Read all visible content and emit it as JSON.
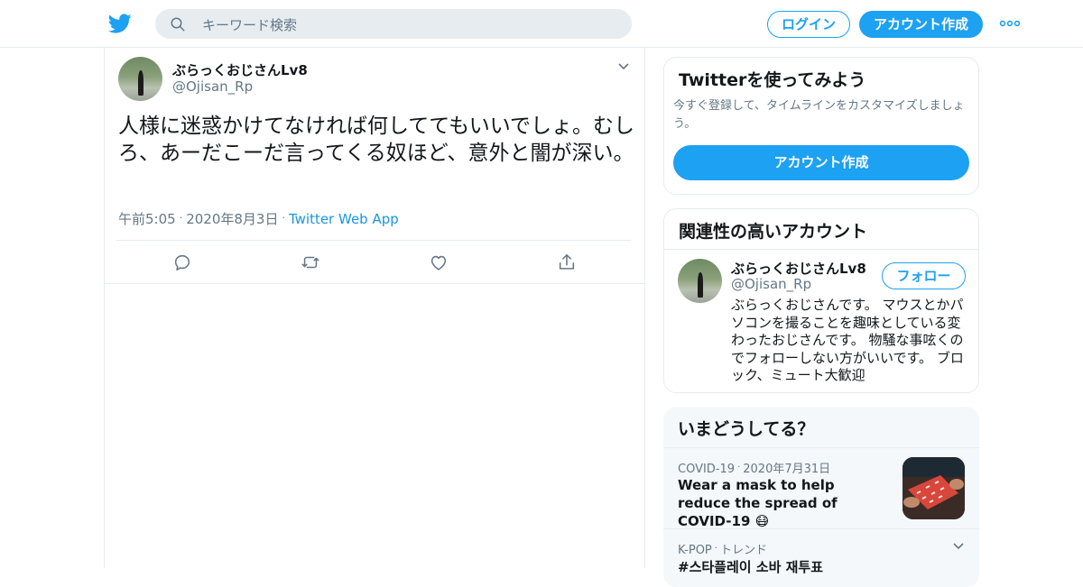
{
  "header": {
    "search_placeholder": "キーワード検索",
    "login_label": "ログイン",
    "signup_label": "アカウント作成"
  },
  "tweet": {
    "display_name": "ぶらっくおじさんLv8",
    "handle": "@Ojisan_Rp",
    "text": "人様に迷惑かけてなければ何しててもいいでしょ。むしろ、あーだこーだ言ってくる奴ほど、意外と闇が深い。",
    "time": "午前5:05",
    "date": "2020年8月3日",
    "source": "Twitter Web App",
    "separator": "·"
  },
  "sidebar": {
    "signup_card": {
      "title": "Twitterを使ってみよう",
      "description": "今すぐ登録して、タイムラインをカスタマイズしましょう。",
      "button_label": "アカウント作成"
    },
    "related_card": {
      "title": "関連性の高いアカウント",
      "account": {
        "display_name": "ぶらっくおじさんLv8",
        "handle": "@Ojisan_Rp",
        "follow_label": "フォロー",
        "bio": "ぶらっくおじさんです。 マウスとかパソコンを撮ることを趣味としている変わったおじさんです。 物騒な事呟くのでフォローしない方がいいです。 ブロック、ミュート大歓迎"
      }
    },
    "trends_card": {
      "title": "いまどうしてる？",
      "items": [
        {
          "category": "COVID-19",
          "date": "2020年7月31日",
          "headline": "Wear a mask to help reduce the spread of COVID-19 😷"
        },
        {
          "category": "K-POP",
          "kind": "トレンド",
          "tag": "#스타플레이 소바 재투표"
        }
      ]
    }
  },
  "colors": {
    "accent": "#1da1f2",
    "link": "#1b95e0",
    "secondary_text": "#657786",
    "border": "#e6ecf0"
  },
  "icons": [
    "twitter-bird-icon",
    "search-icon",
    "more-dots-icon",
    "chevron-down-icon",
    "reply-icon",
    "retweet-icon",
    "like-icon",
    "share-icon"
  ]
}
